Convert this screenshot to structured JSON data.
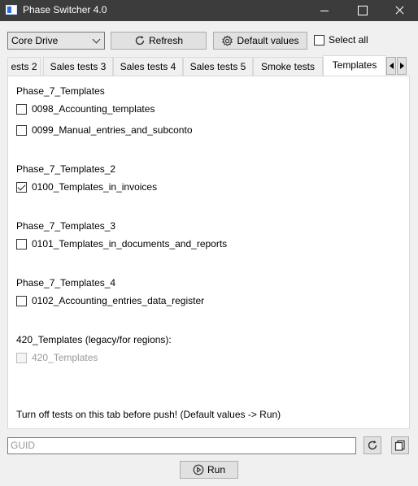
{
  "window": {
    "title": "Phase Switcher 4.0"
  },
  "toolbar": {
    "dropdown_value": "Core Drive",
    "refresh_label": "Refresh",
    "default_values_label": "Default values",
    "select_all_label": "Select all",
    "select_all_checked": false
  },
  "tabs": [
    {
      "label": "ests 2",
      "active": false
    },
    {
      "label": "Sales tests 3",
      "active": false
    },
    {
      "label": "Sales tests 4",
      "active": false
    },
    {
      "label": "Sales tests 5",
      "active": false
    },
    {
      "label": "Smoke tests",
      "active": false
    },
    {
      "label": "Templates",
      "active": true
    }
  ],
  "groups": [
    {
      "title": "Phase_7_Templates",
      "items": [
        {
          "label": "0098_Accounting_templates",
          "checked": false,
          "disabled": false
        },
        {
          "label": "0099_Manual_entries_and_subconto",
          "checked": false,
          "disabled": false
        }
      ]
    },
    {
      "title": "Phase_7_Templates_2",
      "items": [
        {
          "label": "0100_Templates_in_invoices",
          "checked": true,
          "disabled": false
        }
      ]
    },
    {
      "title": "Phase_7_Templates_3",
      "items": [
        {
          "label": "0101_Templates_in_documents_and_reports",
          "checked": false,
          "disabled": false
        }
      ]
    },
    {
      "title": "Phase_7_Templates_4",
      "items": [
        {
          "label": "0102_Accounting_entries_data_register",
          "checked": false,
          "disabled": false
        }
      ]
    },
    {
      "title": "420_Templates (legacy/for regions):",
      "items": [
        {
          "label": "420_Templates",
          "checked": false,
          "disabled": true
        }
      ]
    }
  ],
  "note": "Turn off tests on this tab before push! (Default values -> Run)",
  "guid": {
    "placeholder": "GUID",
    "value": ""
  },
  "run_label": "Run",
  "icons": {
    "refresh": "refresh-icon",
    "default_values": "gear-icon",
    "reload": "reload-icon",
    "copy": "copy-icon",
    "run": "play-icon"
  }
}
